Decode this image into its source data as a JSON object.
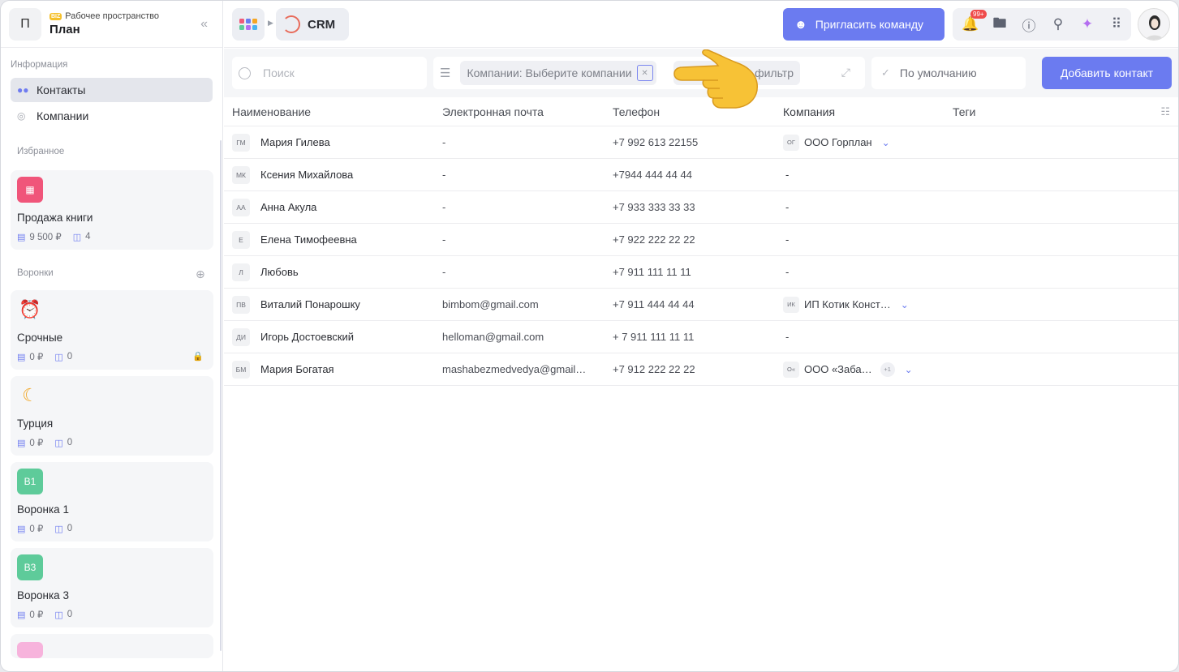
{
  "workspace": {
    "badge": "BIZ",
    "subtitle": "Рабочее пространство",
    "title": "План",
    "avatar_letter": "П"
  },
  "sidebar": {
    "section_info": "Информация",
    "nav": [
      {
        "label": "Контакты",
        "icon": "contacts-icon",
        "active": true
      },
      {
        "label": "Компании",
        "icon": "globe-icon",
        "active": false
      }
    ],
    "section_fav": "Избранное",
    "favorites": [
      {
        "title": "Продажа книги",
        "amount": "9 500 ₽",
        "count": "4",
        "icon": "calendar-icon",
        "color": "#f0557a"
      }
    ],
    "section_funnels": "Воронки",
    "funnels": [
      {
        "title": "Срочные",
        "amount": "0 ₽",
        "count": "0",
        "icon": "alarm-clock-icon",
        "locked": true
      },
      {
        "title": "Турция",
        "amount": "0 ₽",
        "count": "0",
        "icon": "moon-icon",
        "locked": false
      },
      {
        "title": "Воронка 1",
        "amount": "0 ₽",
        "count": "0",
        "badge": "В1",
        "color": "#5ecb9a"
      },
      {
        "title": "Воронка 3",
        "amount": "0 ₽",
        "count": "0",
        "badge": "В3",
        "color": "#5ecb9a"
      }
    ]
  },
  "topbar": {
    "crm_label": "CRM",
    "invite_label": "Пригласить команду",
    "notif_badge": "99+",
    "accent": "#6b7bf0"
  },
  "filters": {
    "search_placeholder": "Поиск",
    "company_chip": "Компании: Выберите компании",
    "add_filter": "фильтр",
    "default_label": "По умолчанию",
    "add_contact": "Добавить контакт"
  },
  "table": {
    "headers": {
      "name": "Наименование",
      "email": "Электронная почта",
      "phone": "Телефон",
      "company": "Компания",
      "tags": "Теги"
    },
    "rows": [
      {
        "ini": "ГМ",
        "name": "Мария Гилева",
        "email": "-",
        "phone": "+7 992 613 22155",
        "cini": "ОГ",
        "company": "ООО Горплан",
        "extra": ""
      },
      {
        "ini": "МК",
        "name": "Ксения Михайлова",
        "email": "-",
        "phone": "+7944 444 44 44",
        "cini": "",
        "company": "-",
        "extra": ""
      },
      {
        "ini": "АА",
        "name": "Анна Акула",
        "email": "-",
        "phone": "+7 933 333 33 33",
        "cini": "",
        "company": "-",
        "extra": ""
      },
      {
        "ini": "Е",
        "name": "Елена Тимофеевна",
        "email": "-",
        "phone": "+7 922 222 22 22",
        "cini": "",
        "company": "-",
        "extra": ""
      },
      {
        "ini": "Л",
        "name": "Любовь",
        "email": "-",
        "phone": "+7 911 111 11 11",
        "cini": "",
        "company": "-",
        "extra": ""
      },
      {
        "ini": "ПВ",
        "name": "Виталий Понарошку",
        "email": "bimbom@gmail.com",
        "phone": "+7 911 444 44 44",
        "cini": "ИК",
        "company": "ИП Котик Конст…",
        "extra": ""
      },
      {
        "ini": "ДИ",
        "name": "Игорь Достоевский",
        "email": "helloman@gmail.com",
        "phone": "+ 7 911 111 11 11",
        "cini": "",
        "company": "-",
        "extra": ""
      },
      {
        "ini": "БМ",
        "name": "Мария Богатая",
        "email": "mashabezmedvedya@gmail…",
        "phone": "+7 912 222 22 22",
        "cini": "О«",
        "company": "ООО «Заба…",
        "extra": "+1"
      }
    ]
  }
}
